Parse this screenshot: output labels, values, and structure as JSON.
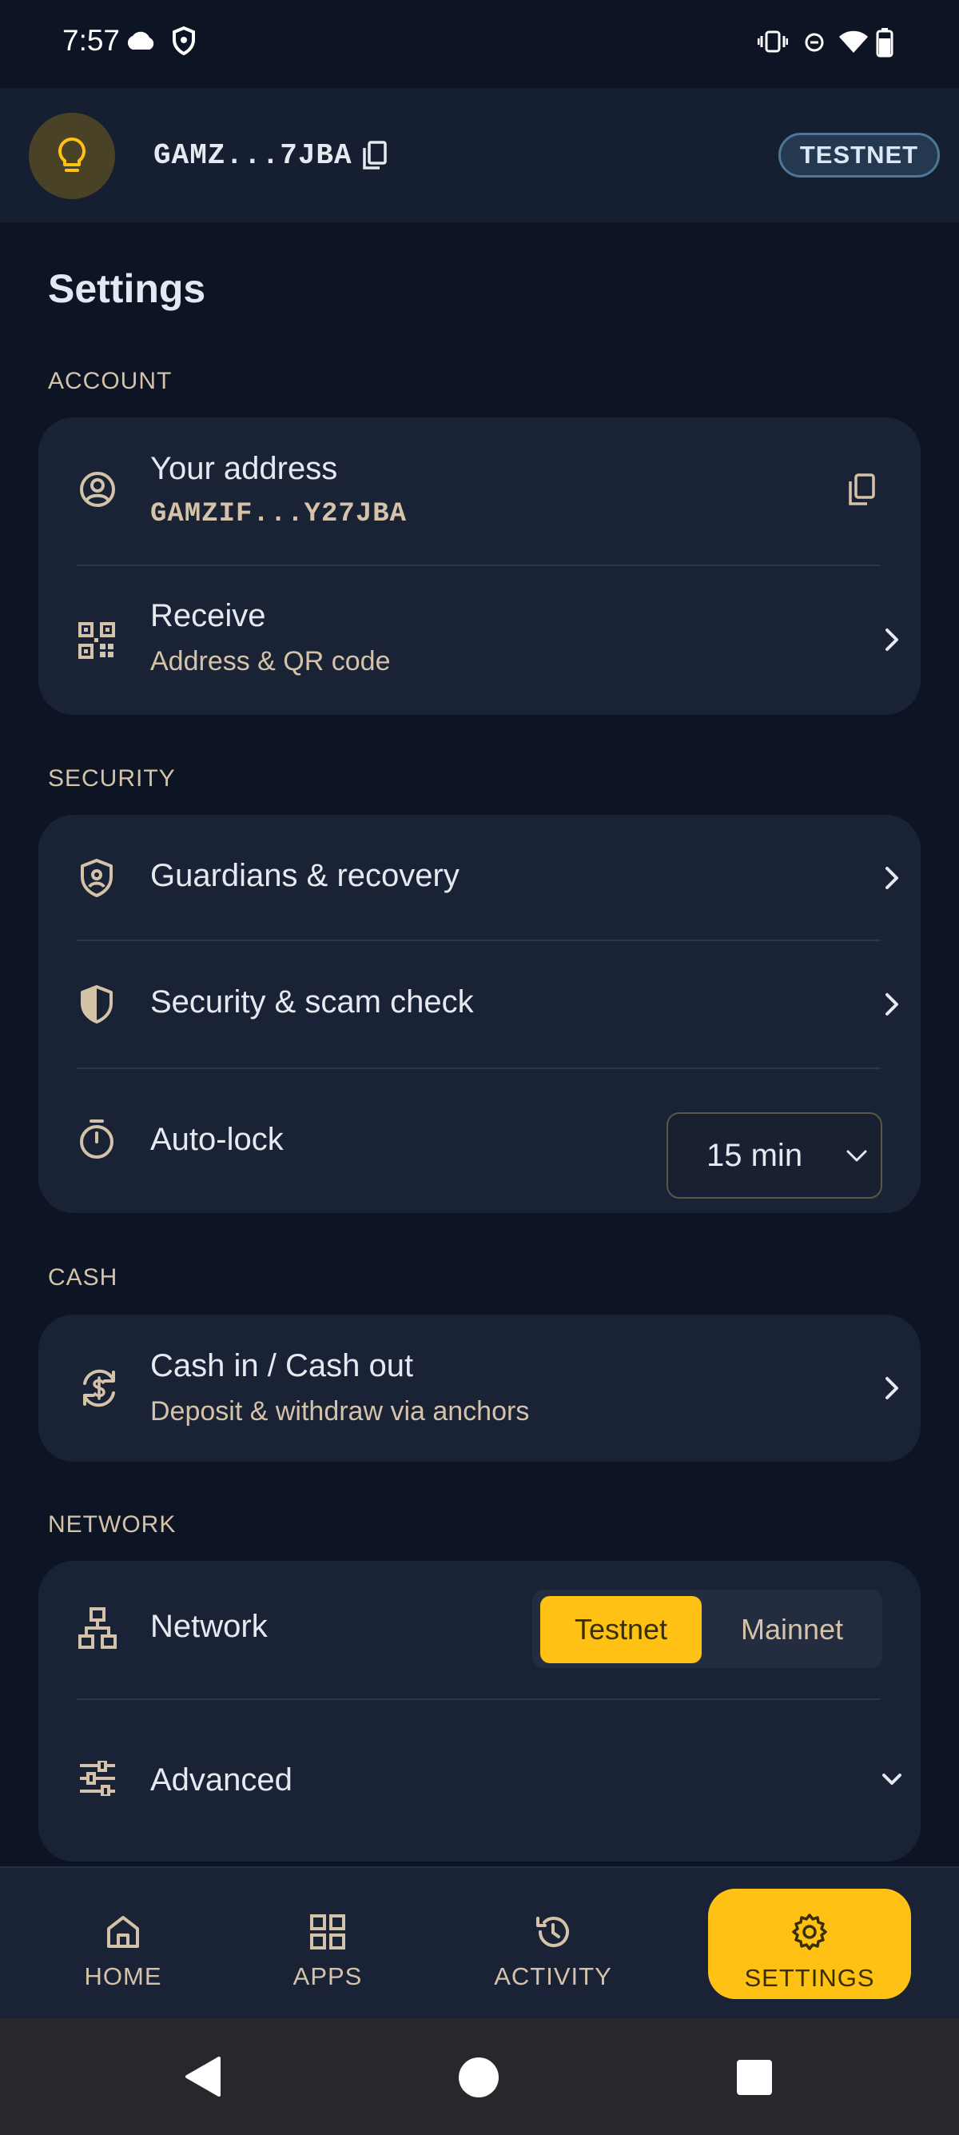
{
  "status": {
    "time": "7:57"
  },
  "header": {
    "address_short": "GAMZ...7JBA",
    "network_badge": "TESTNET"
  },
  "page": {
    "title": "Settings"
  },
  "sections": {
    "account": {
      "label": "ACCOUNT",
      "your_address": {
        "title": "Your address",
        "value": "GAMZIF...Y27JBA"
      },
      "receive": {
        "title": "Receive",
        "subtitle": "Address & QR code"
      }
    },
    "security": {
      "label": "SECURITY",
      "guardians": {
        "title": "Guardians & recovery"
      },
      "scam_check": {
        "title": "Security & scam check"
      },
      "auto_lock": {
        "title": "Auto-lock",
        "value": "15 min"
      }
    },
    "cash": {
      "label": "CASH",
      "cash_in_out": {
        "title": "Cash in / Cash out",
        "subtitle": "Deposit & withdraw via anchors"
      }
    },
    "network": {
      "label": "NETWORK",
      "network": {
        "title": "Network",
        "options": [
          "Testnet",
          "Mainnet"
        ],
        "selected": "Testnet"
      },
      "advanced": {
        "title": "Advanced"
      }
    }
  },
  "bottom_nav": {
    "home": "HOME",
    "apps": "APPS",
    "activity": "ACTIVITY",
    "settings": "SETTINGS",
    "active": "SETTINGS"
  },
  "colors": {
    "accent": "#ffc214",
    "background": "#0d1424",
    "card": "#1a2336",
    "muted": "#d4c3a8"
  }
}
